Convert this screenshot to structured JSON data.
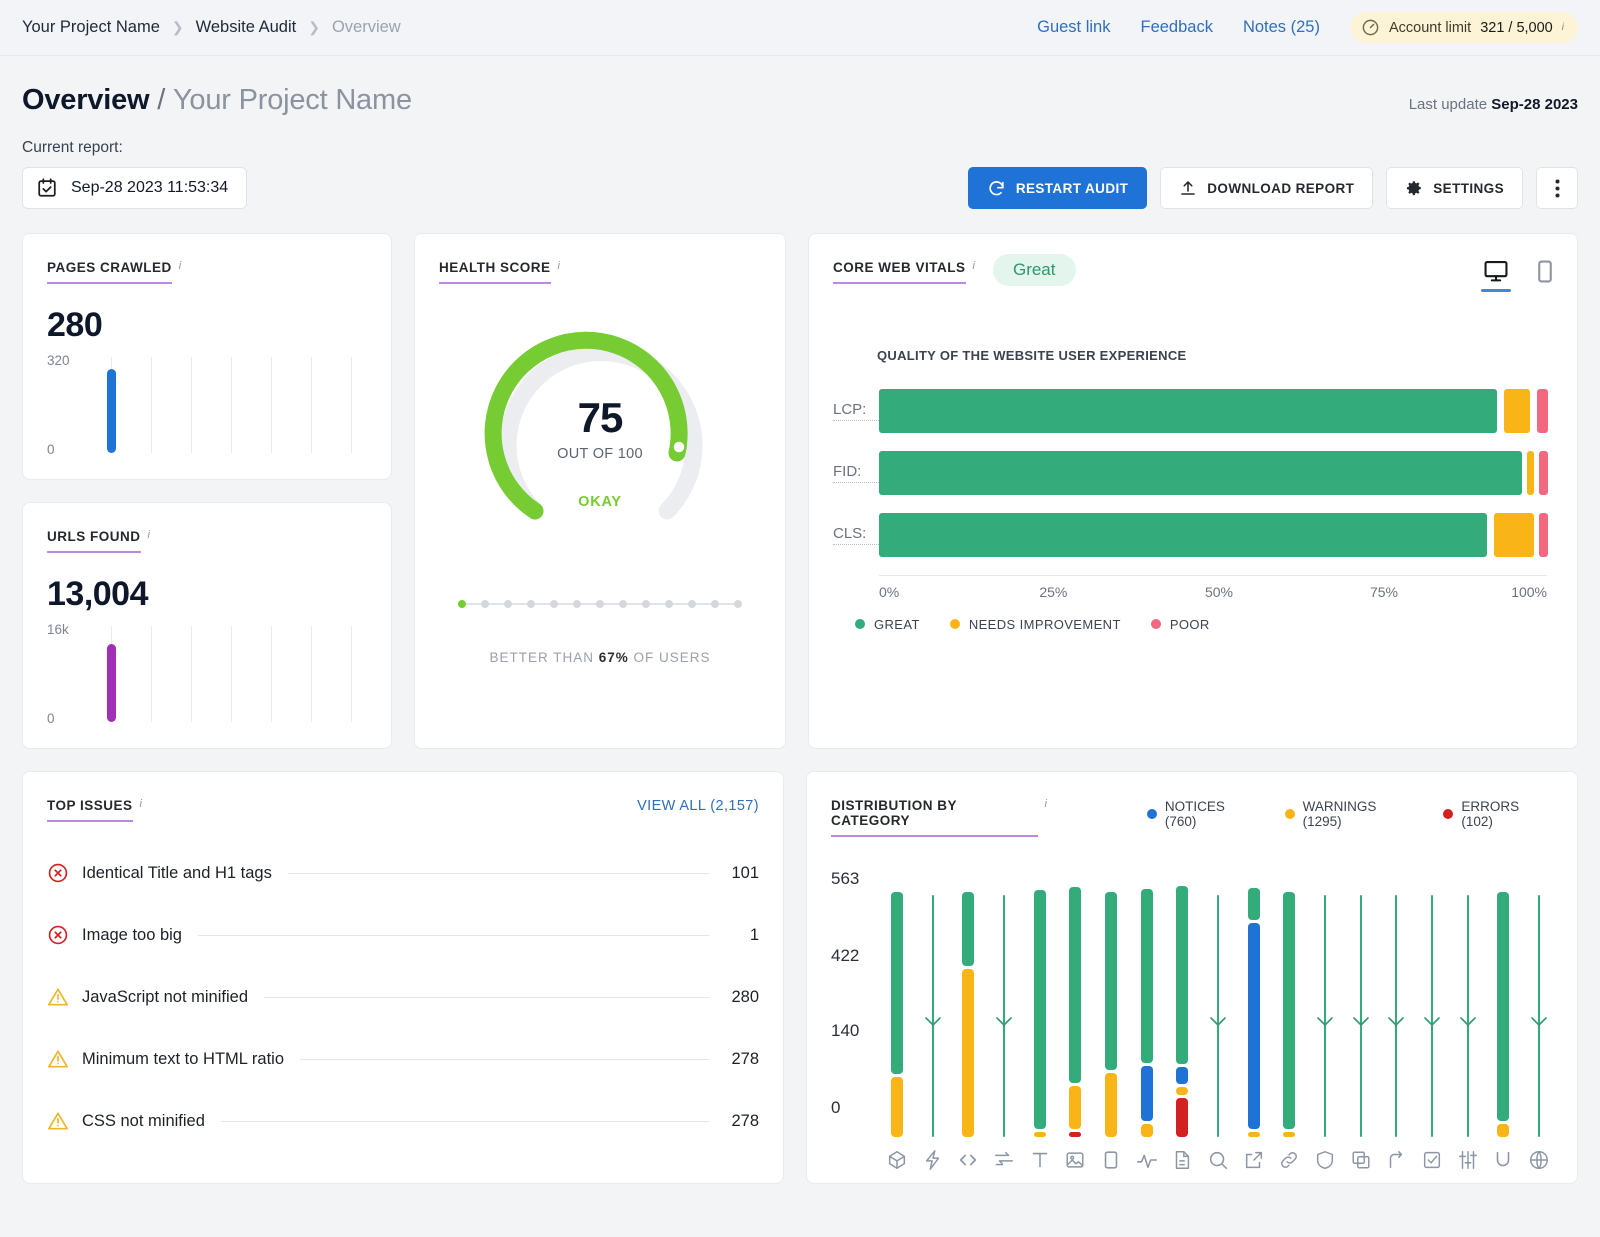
{
  "topbar": {
    "breadcrumbs": [
      {
        "label": "Your Project Name",
        "muted": false
      },
      {
        "label": "Website Audit",
        "muted": false
      },
      {
        "label": "Overview",
        "muted": true
      }
    ],
    "links": [
      "Guest link",
      "Feedback",
      "Notes (25)"
    ],
    "account_limit_label": "Account limit",
    "account_limit_value": "321 / 5,000"
  },
  "header": {
    "title": "Overview",
    "slash": "/",
    "project": "Your Project Name",
    "last_update_label": "Last update",
    "last_update_value": "Sep-28 2023"
  },
  "controls": {
    "current_report_label": "Current report:",
    "report_date": "Sep-28 2023 11:53:34",
    "restart_label": "RESTART AUDIT",
    "download_label": "DOWNLOAD REPORT",
    "settings_label": "SETTINGS"
  },
  "pages_crawled": {
    "title": "PAGES CRAWLED",
    "value": "280",
    "axis_top": "320",
    "axis_bottom": "0"
  },
  "urls_found": {
    "title": "URLS FOUND",
    "value": "13,004",
    "axis_top": "16k",
    "axis_bottom": "0"
  },
  "health_score": {
    "title": "HEALTH SCORE",
    "score": "75",
    "out_of": "OUT OF 100",
    "status": "OKAY",
    "better_prefix": "BETTER THAN",
    "better_value": "67%",
    "better_suffix": "OF USERS"
  },
  "core_web_vitals": {
    "title": "CORE WEB VITALS",
    "badge": "Great",
    "subtitle": "QUALITY OF THE WEBSITE USER EXPERIENCE",
    "ticks": [
      "0%",
      "25%",
      "50%",
      "75%",
      "100%"
    ],
    "legend": [
      {
        "label": "GREAT",
        "color": "#33ab7a"
      },
      {
        "label": "NEEDS IMPROVEMENT",
        "color": "#f9b418"
      },
      {
        "label": "POOR",
        "color": "#f2687f"
      }
    ]
  },
  "top_issues": {
    "title": "TOP ISSUES",
    "view_all": "VIEW ALL (2,157)",
    "items": [
      {
        "label": "Identical Title and H1 tags",
        "count": "101",
        "severity": "error"
      },
      {
        "label": "Image too big",
        "count": "1",
        "severity": "error"
      },
      {
        "label": "JavaScript not minified",
        "count": "280",
        "severity": "warning"
      },
      {
        "label": "Minimum text to HTML ratio",
        "count": "278",
        "severity": "warning"
      },
      {
        "label": "CSS not minified",
        "count": "278",
        "severity": "warning"
      }
    ]
  },
  "distribution": {
    "title": "DISTRIBUTION BY CATEGORY",
    "legend": [
      {
        "label": "NOTICES (760)",
        "color": "#1f73d6"
      },
      {
        "label": "WARNINGS (1295)",
        "color": "#f9b418"
      },
      {
        "label": "ERRORS (102)",
        "color": "#d32020"
      }
    ]
  },
  "chart_data": [
    {
      "type": "bar",
      "name": "core-web-vitals-stacked",
      "title": "QUALITY OF THE WEBSITE USER EXPERIENCE",
      "orientation": "horizontal",
      "categories": [
        "LCP:",
        "FID:",
        "CLS:"
      ],
      "xlabel": "",
      "ylabel": "",
      "xlim": [
        0,
        100
      ],
      "xticks": [
        0,
        25,
        50,
        75,
        100
      ],
      "xticklabels": [
        "0%",
        "25%",
        "50%",
        "75%",
        "100%"
      ],
      "grid": false,
      "legend_position": "bottom-left",
      "series": [
        {
          "name": "GREAT",
          "color": "#33ab7a",
          "values": [
            92.5,
            96.5,
            91.5
          ]
        },
        {
          "name": "NEEDS IMPROVEMENT",
          "color": "#f9b418",
          "values": [
            4.0,
            1.2,
            6.0
          ]
        },
        {
          "name": "POOR",
          "color": "#f2687f",
          "values": [
            2.0,
            1.5,
            1.5
          ]
        }
      ]
    },
    {
      "type": "bar",
      "name": "distribution-by-category",
      "title": "DISTRIBUTION BY CATEGORY",
      "orientation": "vertical-stacked",
      "ylim": [
        0,
        563
      ],
      "yticks": [
        0,
        140,
        422,
        563
      ],
      "yticklabels": [
        "0",
        "140",
        "422",
        "563"
      ],
      "grid": false,
      "legend_position": "top-right",
      "series": [
        {
          "name": "NOTICES (760)",
          "color": "#1f73d6"
        },
        {
          "name": "WARNINGS (1295)",
          "color": "#f9b418"
        },
        {
          "name": "ERRORS (102)",
          "color": "#d32020"
        }
      ],
      "categories": [
        {
          "icon": "crawlability-icon",
          "notices": 0,
          "warnings": 140,
          "errors": 0,
          "other": 423,
          "check": false
        },
        {
          "icon": "performance-lightning-icon",
          "notices": 0,
          "warnings": 0,
          "errors": 0,
          "other": 0,
          "check": true
        },
        {
          "icon": "code-icon",
          "notices": 0,
          "warnings": 390,
          "errors": 0,
          "other": 173,
          "check": false
        },
        {
          "icon": "redirects-icon",
          "notices": 0,
          "warnings": 0,
          "errors": 0,
          "other": 0,
          "check": true
        },
        {
          "icon": "text-title-icon",
          "notices": 0,
          "warnings": 8,
          "errors": 0,
          "other": 555,
          "check": false
        },
        {
          "icon": "image-icon",
          "notices": 0,
          "warnings": 100,
          "errors": 8,
          "other": 455,
          "check": false
        },
        {
          "icon": "mobile-icon",
          "notices": 0,
          "warnings": 150,
          "errors": 0,
          "other": 413,
          "check": false
        },
        {
          "icon": "performance-wave-icon",
          "notices": 128,
          "warnings": 30,
          "errors": 0,
          "other": 405,
          "check": false
        },
        {
          "icon": "document-icon",
          "notices": 40,
          "warnings": 20,
          "errors": 90,
          "other": 413,
          "check": false
        },
        {
          "icon": "search-icon",
          "notices": 0,
          "warnings": 0,
          "errors": 0,
          "other": 0,
          "check": true
        },
        {
          "icon": "external-link-icon",
          "notices": 480,
          "warnings": 10,
          "errors": 0,
          "other": 73,
          "check": false
        },
        {
          "icon": "link-chain-icon",
          "notices": 0,
          "warnings": 12,
          "errors": 0,
          "other": 551,
          "check": false
        },
        {
          "icon": "shield-icon",
          "notices": 0,
          "warnings": 0,
          "errors": 0,
          "other": 0,
          "check": true
        },
        {
          "icon": "copy-icon",
          "notices": 0,
          "warnings": 0,
          "errors": 0,
          "other": 0,
          "check": true
        },
        {
          "icon": "redirect-arrow-icon",
          "notices": 0,
          "warnings": 0,
          "errors": 0,
          "other": 0,
          "check": true
        },
        {
          "icon": "checklist-icon",
          "notices": 0,
          "warnings": 0,
          "errors": 0,
          "other": 0,
          "check": true
        },
        {
          "icon": "sliders-icon",
          "notices": 0,
          "warnings": 0,
          "errors": 0,
          "other": 0,
          "check": true
        },
        {
          "icon": "underline-icon",
          "notices": 0,
          "warnings": 30,
          "errors": 0,
          "other": 533,
          "check": false
        },
        {
          "icon": "globe-icon",
          "notices": 0,
          "warnings": 0,
          "errors": 0,
          "other": 0,
          "check": true
        }
      ]
    },
    {
      "type": "bar",
      "name": "pages-crawled-sparkline",
      "categories": [
        "Sep-28 2023"
      ],
      "values": [
        280
      ],
      "ylim": [
        0,
        320
      ],
      "title": "PAGES CRAWLED",
      "color": "#1f73d6"
    },
    {
      "type": "bar",
      "name": "urls-found-sparkline",
      "categories": [
        "Sep-28 2023"
      ],
      "values": [
        13004
      ],
      "ylim": [
        0,
        16000
      ],
      "title": "URLS FOUND",
      "color": "#a02fb5"
    },
    {
      "type": "pie",
      "name": "health-score-gauge",
      "title": "HEALTH SCORE",
      "values": [
        75,
        25
      ],
      "categories": [
        "score",
        "remaining"
      ],
      "ylim": [
        0,
        100
      ],
      "color": "#76cc32"
    }
  ]
}
